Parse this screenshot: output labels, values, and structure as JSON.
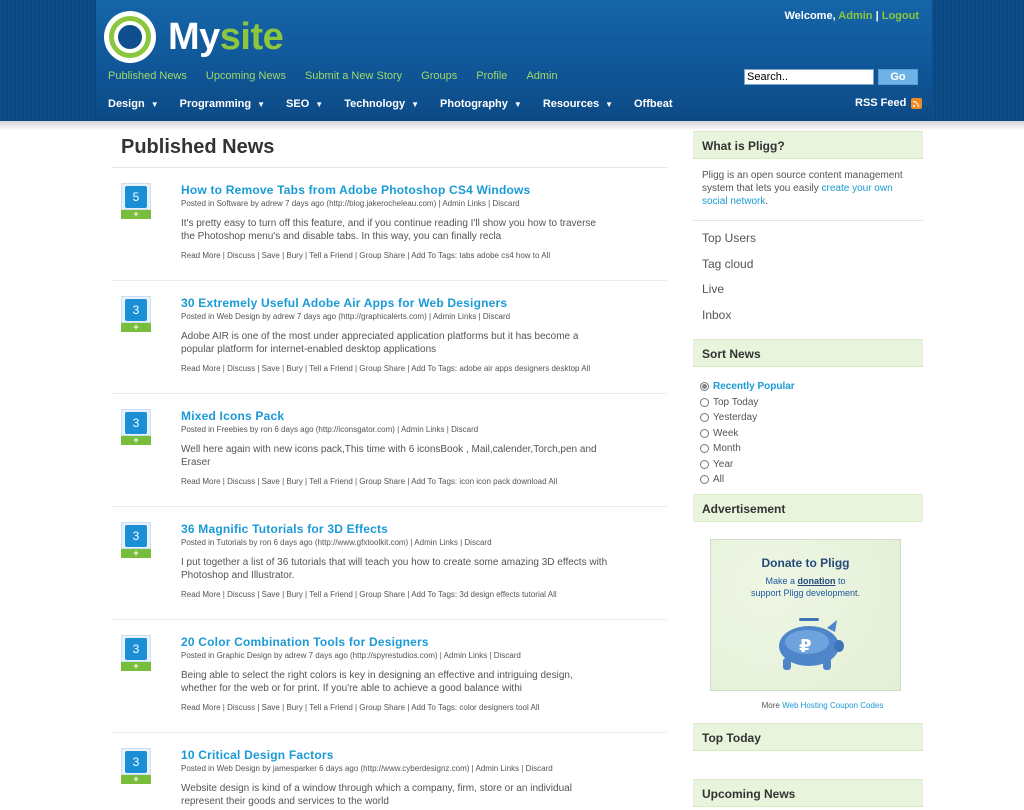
{
  "header": {
    "site_name_part1": "My",
    "site_name_part2": "site",
    "welcome_prefix": "Welcome,",
    "welcome_user": "Admin",
    "welcome_sep": "|",
    "logout": "Logout",
    "search_value": "Search..",
    "go_label": "Go",
    "rss_label": "RSS Feed",
    "top_nav": [
      "Published News",
      "Upcoming News",
      "Submit a New Story",
      "Groups",
      "Profile",
      "Admin"
    ],
    "categories": [
      {
        "label": "Design",
        "caret": "▼"
      },
      {
        "label": "Programming",
        "caret": "▼"
      },
      {
        "label": "SEO",
        "caret": "▼"
      },
      {
        "label": "Technology",
        "caret": "▼"
      },
      {
        "label": "Photography",
        "caret": "▼"
      },
      {
        "label": "Resources",
        "caret": "▼"
      },
      {
        "label": "Offbeat",
        "caret": ""
      }
    ]
  },
  "main": {
    "title": "Published News",
    "plus": "+",
    "stories": [
      {
        "votes": "5",
        "title": "How to Remove Tabs from Adobe Photoshop CS4 Windows",
        "meta": "Posted in Software by adrew 7 days ago (http://blog.jakerocheleau.com) | Admin Links | Discard",
        "desc": "It's pretty easy to turn off this feature, and if you continue reading I'll show you how to traverse the Photoshop menu's and disable tabs. In this way, you can finally recla",
        "actions": "Read More | Discuss |   Save   | Bury |  Tell a Friend  |  Group Share |  Add To Tags: tabs adobe cs4 how to All"
      },
      {
        "votes": "3",
        "title": "30 Extremely Useful Adobe Air Apps for Web Designers",
        "meta": "Posted in Web Design by adrew 7 days ago (http://graphicalerts.com) | Admin Links | Discard",
        "desc": "Adobe AIR is one of the most under appreciated application platforms but it has become a popular platform for internet-enabled desktop applications",
        "actions": "Read More | Discuss |   Save   | Bury |  Tell a Friend  |  Group Share |  Add To Tags: adobe air apps designers desktop All"
      },
      {
        "votes": "3",
        "title": "Mixed Icons Pack",
        "meta": "Posted in Freebies by ron 6 days ago (http://iconsgator.com) | Admin Links | Discard",
        "desc": "Well here again with new icons pack,This time with 6 iconsBook , Mail,calender,Torch,pen and Eraser",
        "actions": "Read More | Discuss |   Save   | Bury |  Tell a Friend  |  Group Share |  Add To Tags: icon icon pack download All"
      },
      {
        "votes": "3",
        "title": "36 Magnific Tutorials for 3D Effects",
        "meta": "Posted in Tutorials by ron 6 days ago (http://www.gfxtoolkit.com) | Admin Links | Discard",
        "desc": "I put together a list of 36 tutorials that will teach you how to create some amazing 3D effects with Photoshop and Illustrator.",
        "actions": "Read More | Discuss |   Save   | Bury |  Tell a Friend  |  Group Share |  Add To Tags: 3d design effects tutorial All"
      },
      {
        "votes": "3",
        "title": "20 Color Combination Tools for Designers",
        "meta": "Posted in Graphic Design by adrew 7 days ago (http://spyrestudios.com) | Admin Links | Discard",
        "desc": "Being able to select the right colors is key in designing an effective and intriguing design, whether for the web or for print. If you're able to achieve a good balance withi",
        "actions": "Read More | Discuss |   Save   | Bury |  Tell a Friend  |  Group Share |  Add To Tags: color designers tool All"
      },
      {
        "votes": "3",
        "title": "10 Critical Design Factors",
        "meta": "Posted in Web Design by jamesparker 6 days ago (http://www.cyberdesignz.com) | Admin Links | Discard",
        "desc": "Website  design is kind of a window through which a company, firm, store or an individual represent their goods and services to the world",
        "actions": ""
      }
    ]
  },
  "sidebar": {
    "what_is_title": "What is Pligg?",
    "what_is_text": "Pligg is an open source content management system that lets you easily ",
    "what_is_link": "create your own social network",
    "what_is_end": ".",
    "links": [
      "Top Users",
      "Tag cloud",
      "Live",
      "Inbox"
    ],
    "sort_title": "Sort News",
    "sort_options": [
      "Recently Popular",
      "Top Today",
      "Yesterday",
      "Week",
      "Month",
      "Year",
      "All"
    ],
    "ad_title": "Advertisement",
    "ad_heading": "Donate to Pligg",
    "ad_line1_pre": "Make a ",
    "ad_line1_link": "donation",
    "ad_line1_post": " to",
    "ad_line2": "support Pligg development.",
    "ad_more_prefix": "More ",
    "ad_more_link": "Web Hosting Coupon Codes",
    "top_today_title": "Top Today",
    "upcoming_title": "Upcoming News"
  },
  "colors": {
    "header_blue": "#0f5596",
    "accent_green": "#8cc63f",
    "link_blue": "#1a9ad6",
    "sidebar_head_bg": "#e8f5dc"
  }
}
